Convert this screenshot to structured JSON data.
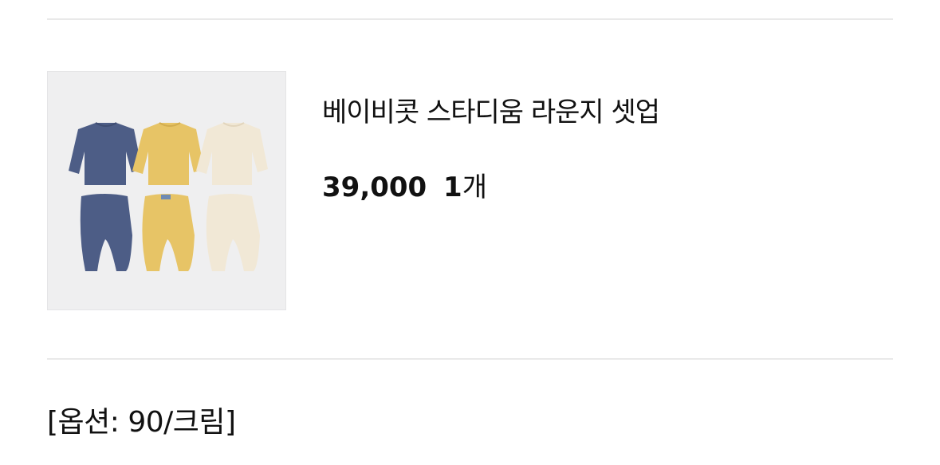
{
  "product": {
    "name": "베이비콧 스타디움 라운지 셋업",
    "price": "39,000",
    "quantity": "1",
    "quantity_unit": "개",
    "image_icon": "product-photo",
    "colors": {
      "navy": "#4d5d86",
      "mustard": "#e7c466",
      "cream": "#f1e8d6",
      "image_bg": "#efeff0"
    }
  },
  "option": {
    "text": "[옵션: 90/크림]"
  }
}
